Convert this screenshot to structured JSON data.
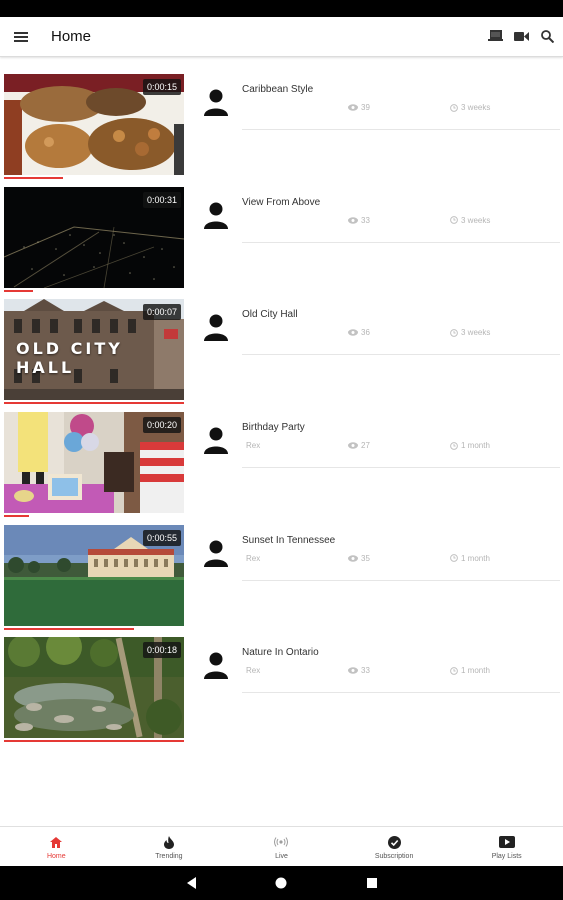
{
  "app_bar": {
    "title": "Home"
  },
  "videos": [
    {
      "title": "Caribbean Style",
      "channel": "",
      "views": "39",
      "age": "3 weeks",
      "duration": "0:00:15",
      "watched_fraction": 0.33,
      "overlay": ""
    },
    {
      "title": "View From Above",
      "channel": "",
      "views": "33",
      "age": "3 weeks",
      "duration": "0:00:31",
      "watched_fraction": 0.16,
      "overlay": ""
    },
    {
      "title": "Old City Hall",
      "channel": "",
      "views": "36",
      "age": "3 weeks",
      "duration": "0:00:07",
      "watched_fraction": 1.0,
      "overlay": "OLD CITY HALL"
    },
    {
      "title": "Birthday Party",
      "channel": "Rex",
      "views": "27",
      "age": "1 month",
      "duration": "0:00:20",
      "watched_fraction": 0.14,
      "overlay": ""
    },
    {
      "title": "Sunset In Tennessee",
      "channel": "Rex",
      "views": "35",
      "age": "1 month",
      "duration": "0:00:55",
      "watched_fraction": 0.72,
      "overlay": ""
    },
    {
      "title": "Nature In Ontario",
      "channel": "Rex",
      "views": "33",
      "age": "1 month",
      "duration": "0:00:18",
      "watched_fraction": 1.0,
      "overlay": ""
    }
  ],
  "bottom_nav": {
    "items": [
      {
        "label": "Home",
        "icon": "home-icon"
      },
      {
        "label": "Trending",
        "icon": "flame-icon"
      },
      {
        "label": "Live",
        "icon": "broadcast-icon"
      },
      {
        "label": "Subscription",
        "icon": "check-circle-icon"
      },
      {
        "label": "Play Lists",
        "icon": "playlist-icon"
      }
    ],
    "active_index": 0
  },
  "colors": {
    "accent": "#e53935",
    "meta_text": "#b5b5b5"
  }
}
